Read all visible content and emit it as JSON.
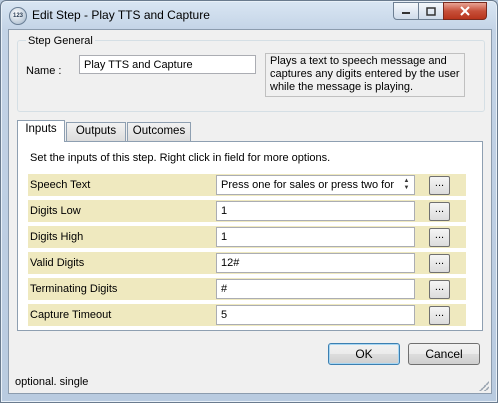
{
  "window": {
    "title": "Edit Step - Play TTS and Capture",
    "icon_label": "123",
    "controls": {
      "minimize": "minimize-icon",
      "maximize": "maximize-icon",
      "close": "close-icon"
    }
  },
  "general": {
    "group_label": "Step General",
    "name_label": "Name :",
    "name_value": "Play TTS and Capture",
    "description": "Plays a text to speech message and captures any digits entered by the user while the message is playing."
  },
  "tabs": [
    {
      "label": "Inputs",
      "active": true
    },
    {
      "label": "Outputs",
      "active": false
    },
    {
      "label": "Outcomes",
      "active": false
    }
  ],
  "inputs_panel": {
    "hint": "Set the inputs of this step.  Right click in field for more options.",
    "button_label": "...",
    "rows": [
      {
        "label": "Speech Text",
        "value": "Press one for sales or press two for"
      },
      {
        "label": "Digits Low",
        "value": "1"
      },
      {
        "label": "Digits High",
        "value": "1"
      },
      {
        "label": "Valid Digits",
        "value": "12#"
      },
      {
        "label": "Terminating Digits",
        "value": "#"
      },
      {
        "label": "Capture Timeout",
        "value": "5"
      }
    ]
  },
  "buttons": {
    "ok": "OK",
    "cancel": "Cancel"
  },
  "status": {
    "text": "optional. single"
  },
  "colors": {
    "row_background": "#efe9bf",
    "window_frame": "#b9cbe0"
  }
}
